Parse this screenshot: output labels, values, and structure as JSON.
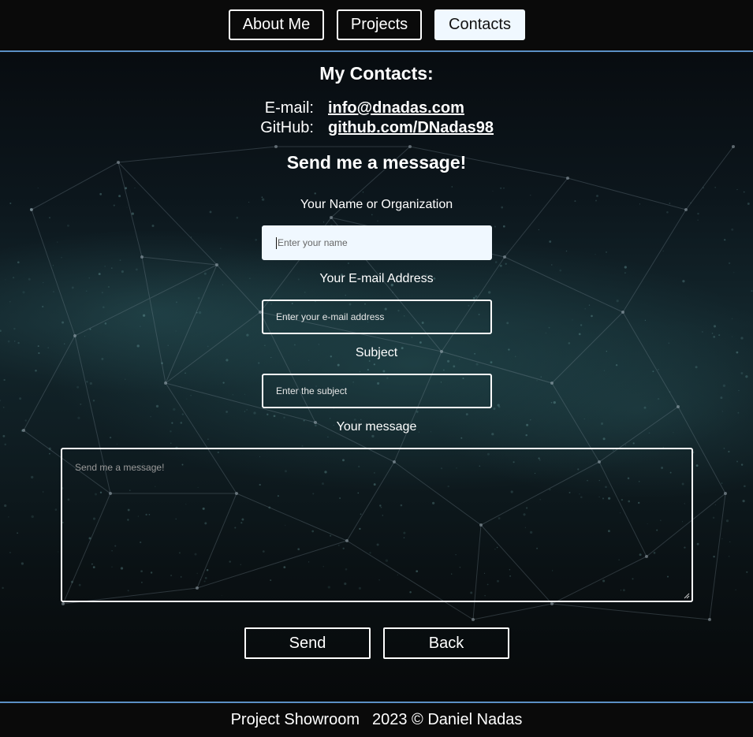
{
  "nav": {
    "about_label": "About Me",
    "projects_label": "Projects",
    "contacts_label": "Contacts",
    "active": "Contacts"
  },
  "contacts": {
    "heading": "My Contacts:",
    "email_label": "E-mail:",
    "email_value": "info@dnadas.com",
    "github_label": "GitHub:",
    "github_value": "github.com/DNadas98"
  },
  "form": {
    "heading": "Send me a message!",
    "name_label": "Your Name or Organization",
    "name_placeholder": "Enter your name",
    "email_label": "Your E-mail Address",
    "email_placeholder": "Enter your e-mail address",
    "subject_label": "Subject",
    "subject_placeholder": "Enter the subject",
    "message_label": "Your message",
    "message_placeholder": "Send me a message!",
    "send_label": "Send",
    "back_label": "Back"
  },
  "footer": {
    "project_text": "Project Showroom",
    "copyright_text": "2023 © Daniel Nadas"
  },
  "colors": {
    "accent_border": "#5b8fc5",
    "active_tab_bg": "#f0f8ff",
    "background": "#0a0a0a"
  }
}
